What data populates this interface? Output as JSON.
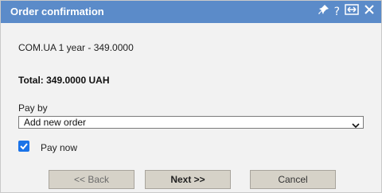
{
  "dialog": {
    "title": "Order confirmation",
    "title_icons": [
      "pin-icon",
      "help-icon",
      "resize-icon",
      "close-icon"
    ],
    "accent_color": "#5b8bc9"
  },
  "order": {
    "line": "COM.UA 1 year - 349.0000",
    "total": "Total: 349.0000 UAH"
  },
  "payment": {
    "label": "Pay by",
    "selected": "Add new order",
    "pay_now_checked": true,
    "pay_now_label": "Pay now"
  },
  "buttons": {
    "back": "<< Back",
    "next": "Next >>",
    "cancel": "Cancel"
  }
}
